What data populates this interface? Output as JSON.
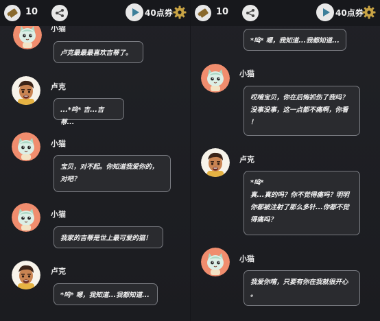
{
  "topbar": {
    "ticket_count": "10",
    "coupon_label": "40点券"
  },
  "left": {
    "messages": [
      {
        "speaker": "小猫",
        "avatar": "cat",
        "text": "卢克最最最喜欢吉蒂了。"
      },
      {
        "speaker": "卢克",
        "avatar": "luke",
        "text": "...*呜* 吉...吉蒂..."
      },
      {
        "speaker": "小猫",
        "avatar": "cat",
        "text": "宝贝，对不起。你知道我爱你的，\n对吧？"
      },
      {
        "speaker": "小猫",
        "avatar": "cat",
        "text": "我家的吉蒂是世上最可爱的猫！"
      },
      {
        "speaker": "卢克",
        "avatar": "luke",
        "text": "*呜* 嗯，我知道...我都知道..."
      }
    ]
  },
  "right": {
    "messages": [
      {
        "speaker": "",
        "avatar": "",
        "text": "*呜* 嗯，我知道...我都知道..."
      },
      {
        "speaker": "小猫",
        "avatar": "cat",
        "text": "哎唷宝贝，你在后悔抓伤了我吗？\n没事没事，这一点都不痛啊，你看\n！"
      },
      {
        "speaker": "卢克",
        "avatar": "luke",
        "text": "*呜*\n真...真的吗？你不觉得痛吗？明明\n你都被注射了那么多针...你都不觉\n得痛吗？"
      },
      {
        "speaker": "小猫",
        "avatar": "cat",
        "text": "我爱你唷，只要有你在我就很开心\n。"
      }
    ]
  },
  "icons": {
    "ticket": "ticket-icon",
    "share": "share-icon",
    "play": "play-icon",
    "settings": "gear-icon"
  },
  "colors": {
    "background": "#1c1d21",
    "bubble": "#2a2b2f",
    "bubble_border": "#7a7c82",
    "cat_avatar_bg": "#f08d6e",
    "accent_gold": "#c9a445",
    "play_blue": "#3c7f9a"
  }
}
